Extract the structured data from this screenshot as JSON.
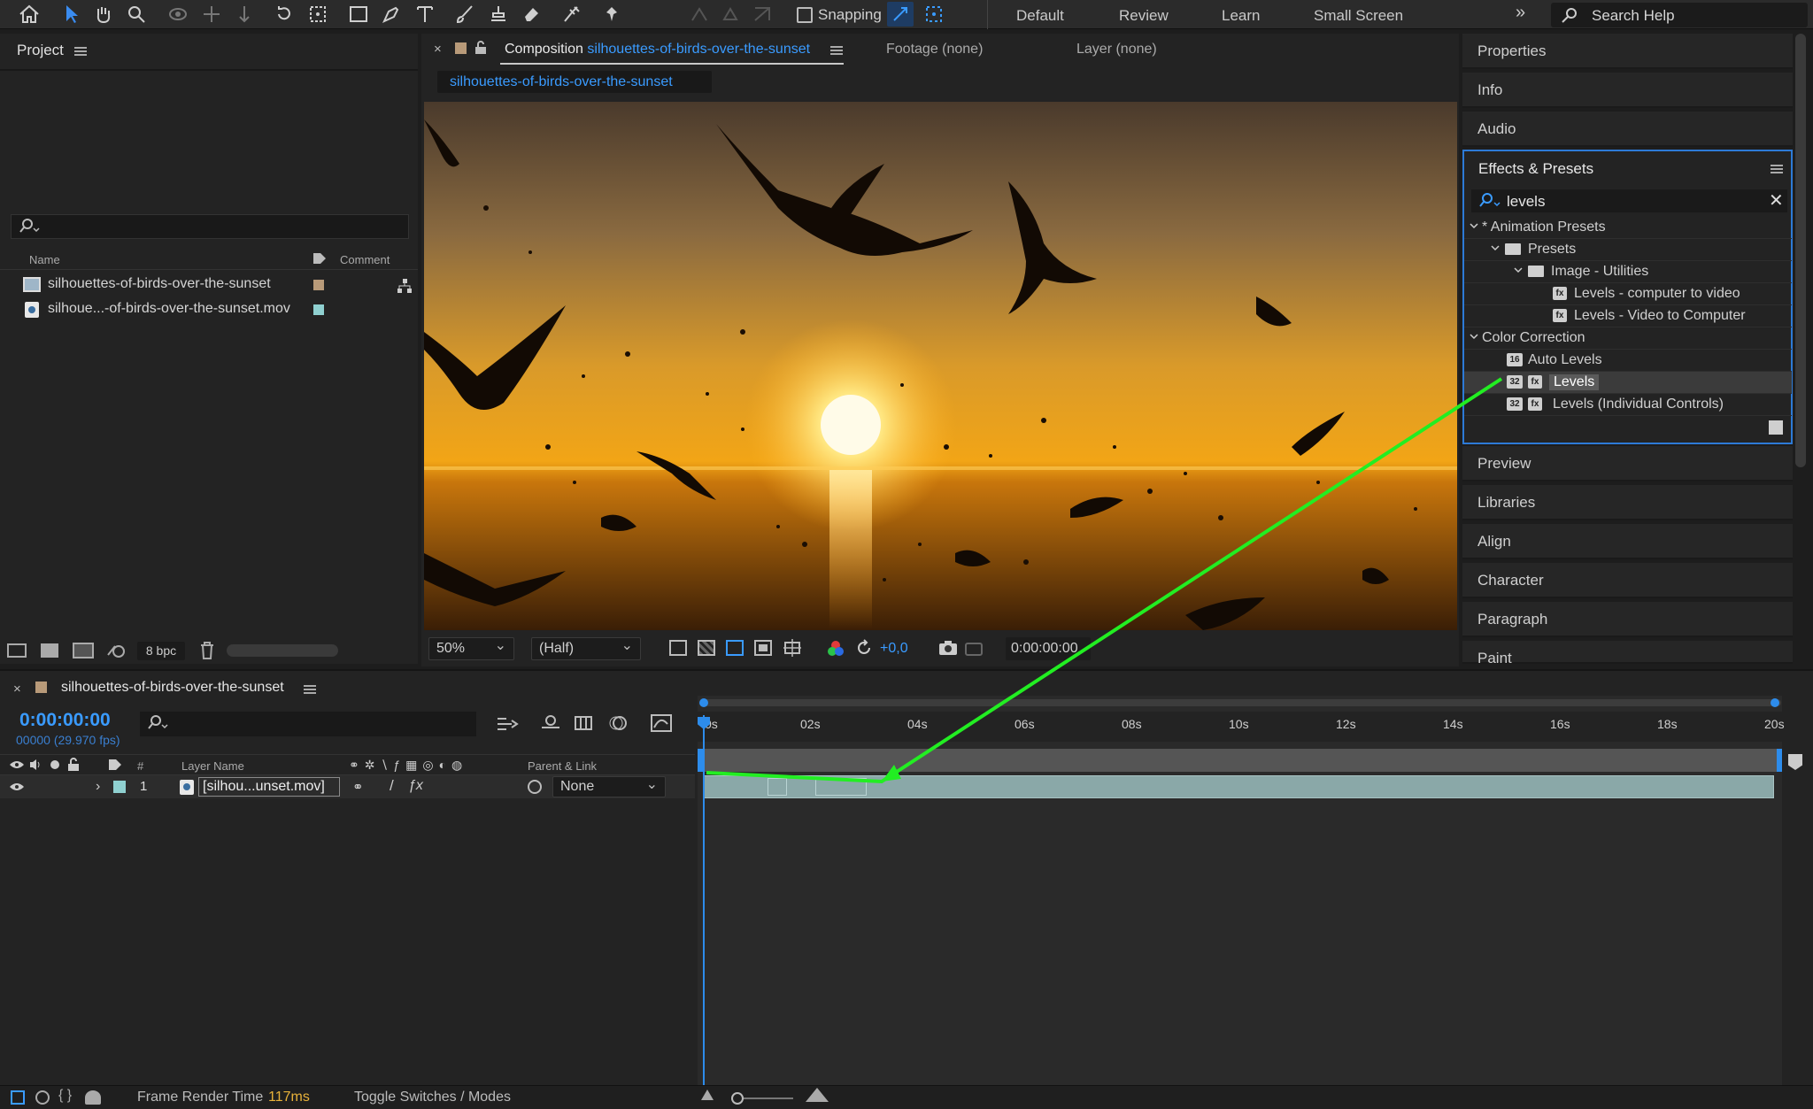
{
  "toolbar": {
    "snapping_label": "Snapping",
    "workspaces": [
      "Default",
      "Review",
      "Learn",
      "Small Screen"
    ],
    "search_help_placeholder": "Search Help"
  },
  "project": {
    "title": "Project",
    "columns": {
      "name": "Name",
      "comment": "Comment"
    },
    "items": [
      {
        "name": "silhouettes-of-birds-over-the-sunset",
        "label_color": "#b89a79"
      },
      {
        "name": "silhoue...-of-birds-over-the-sunset.mov",
        "label_color": "#8fd0d0"
      }
    ],
    "bpc": "8 bpc"
  },
  "composition": {
    "tab_prefix": "Composition",
    "tab_name": "silhouettes-of-birds-over-the-sunset",
    "footage_tab": "Footage (none)",
    "layer_tab": "Layer (none)",
    "breadcrumb": "silhouettes-of-birds-over-the-sunset",
    "zoom": "50%",
    "resolution": "(Half)",
    "exposure": "+0,0",
    "timecode": "0:00:00:00"
  },
  "right_panels": {
    "top": [
      "Properties",
      "Info",
      "Audio"
    ],
    "bottom": [
      "Preview",
      "Libraries",
      "Align",
      "Character",
      "Paragraph",
      "Paint"
    ]
  },
  "effects_presets": {
    "title": "Effects & Presets",
    "search_value": "levels",
    "tree": {
      "animation_presets": "* Animation Presets",
      "presets": "Presets",
      "image_utilities": "Image - Utilities",
      "preset_1": "Levels - computer to video",
      "preset_2": "Levels - Video to Computer",
      "color_correction": "Color Correction",
      "auto_levels": "Auto Levels",
      "levels": "Levels",
      "levels_individual": "Levels (Individual Controls)"
    }
  },
  "timeline": {
    "comp_name": "silhouettes-of-birds-over-the-sunset",
    "current_time": "0:00:00:00",
    "frame_info": "00000 (29.970 fps)",
    "columns": {
      "num": "#",
      "layer_name": "Layer Name",
      "parent": "Parent & Link"
    },
    "layer": {
      "index": "1",
      "name": "[silhou...unset.mov]",
      "parent": "None"
    },
    "ruler": [
      "0s",
      "02s",
      "04s",
      "06s",
      "08s",
      "10s",
      "12s",
      "14s",
      "16s",
      "18s",
      "20s"
    ]
  },
  "status": {
    "frame_render_label": "Frame Render Time",
    "frame_render_value": "117ms",
    "toggle_label": "Toggle Switches / Modes"
  },
  "colors": {
    "accent_blue": "#2d8ceb",
    "link_blue": "#3a9bff",
    "annotation_green": "#22ee22",
    "render_time": "#e8b23a",
    "layer_bar": "#8aa8a8"
  }
}
